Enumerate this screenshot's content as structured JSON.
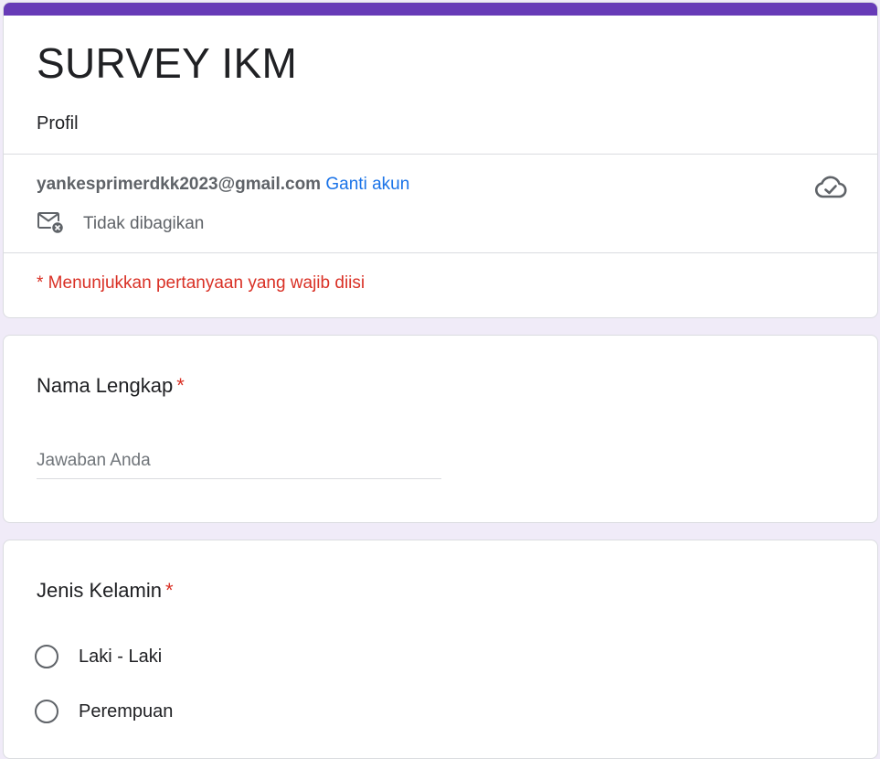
{
  "form": {
    "title": "SURVEY IKM",
    "description": "Profil",
    "accent_color": "#673ab7",
    "background_color": "#f0ebf8"
  },
  "account": {
    "email": "yankesprimerdkk2023@gmail.com",
    "switch_label": "Ganti akun",
    "not_shared_label": "Tidak dibagikan",
    "saved_icon": "cloud-done-icon"
  },
  "required_note": "* Menunjukkan pertanyaan yang wajib diisi",
  "questions": [
    {
      "title": "Nama Lengkap",
      "required_mark": "*",
      "type": "short-answer",
      "placeholder": "Jawaban Anda"
    },
    {
      "title": "Jenis Kelamin",
      "required_mark": "*",
      "type": "radio",
      "options": [
        "Laki - Laki",
        "Perempuan"
      ]
    }
  ]
}
